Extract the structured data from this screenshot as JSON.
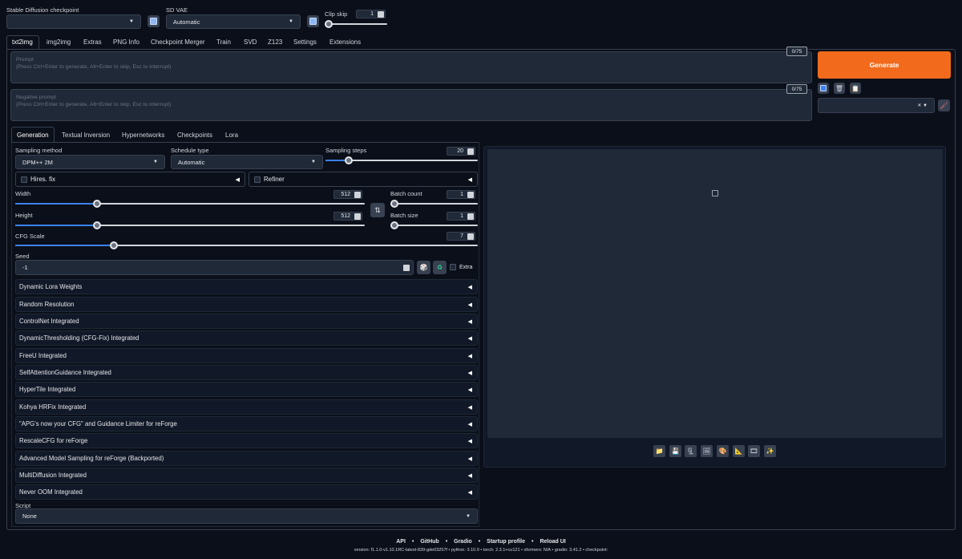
{
  "top": {
    "checkpoint_label": "Stable Diffusion checkpoint",
    "checkpoint_value": "",
    "vae_label": "SD VAE",
    "vae_value": "Automatic",
    "clip_skip_label": "Clip skip",
    "clip_skip_value": "1",
    "clip_skip_level": 0.0
  },
  "main_tabs": [
    "txt2img",
    "img2img",
    "Extras",
    "PNG Info",
    "Checkpoint Merger",
    "Train",
    "SVD",
    "Z123",
    "Settings",
    "Extensions"
  ],
  "prompt": {
    "label": "Prompt",
    "hint": "(Press Ctrl+Enter to generate, Alt+Enter to skip, Esc to interrupt)",
    "counter": "0/75"
  },
  "negative_prompt": {
    "label": "Negative prompt",
    "hint": "(Press Ctrl+Enter to generate, Alt+Enter to skip, Esc to interrupt)",
    "counter": "0/75"
  },
  "generate_label": "Generate",
  "sub_tabs": [
    "Generation",
    "Textual Inversion",
    "Hypernetworks",
    "Checkpoints",
    "Lora"
  ],
  "generation": {
    "sampling_method_label": "Sampling method",
    "sampling_method_value": "DPM++ 2M",
    "schedule_type_label": "Schedule type",
    "schedule_type_value": "Automatic",
    "sampling_steps_label": "Sampling steps",
    "sampling_steps_value": "20",
    "hires_label": "Hires. fix",
    "refiner_label": "Refiner",
    "width_label": "Width",
    "width_value": "512",
    "height_label": "Height",
    "height_value": "512",
    "batch_count_label": "Batch count",
    "batch_count_value": "1",
    "batch_size_label": "Batch size",
    "batch_size_value": "1",
    "cfg_label": "CFG Scale",
    "cfg_value": "7",
    "seed_label": "Seed",
    "seed_value": "-1",
    "extra_label": "Extra",
    "script_label": "Script",
    "script_value": "None"
  },
  "accordions": [
    "Dynamic Lora Weights",
    "Random Resolution",
    "ControlNet Integrated",
    "DynamicThresholding (CFG-Fix) Integrated",
    "FreeU Integrated",
    "SelfAttentionGuidance Integrated",
    "HyperTile Integrated",
    "Kohya HRFix Integrated",
    "\"APG's now your CFG\" and Guidance Limiter for reForge",
    "RescaleCFG for reForge",
    "Advanced Model Sampling for reForge (Backported)",
    "MultiDiffusion Integrated",
    "Never OOM Integrated"
  ],
  "footer": {
    "links": [
      "API",
      "GitHub",
      "Gradio",
      "Startup profile",
      "Reload UI"
    ],
    "version_line": "version: f1.1.0-v1.10.1RC-latest-839-gde03257f  •  python: 3.10.9  •  torch: 2.3.1+cu121  •  xformers: N/A  •  gradio: 3.41.2  •  checkpoint:"
  },
  "colors": {
    "background": "#0b0f19",
    "generate": "#f26a1b",
    "accent": "#3b82f6"
  }
}
